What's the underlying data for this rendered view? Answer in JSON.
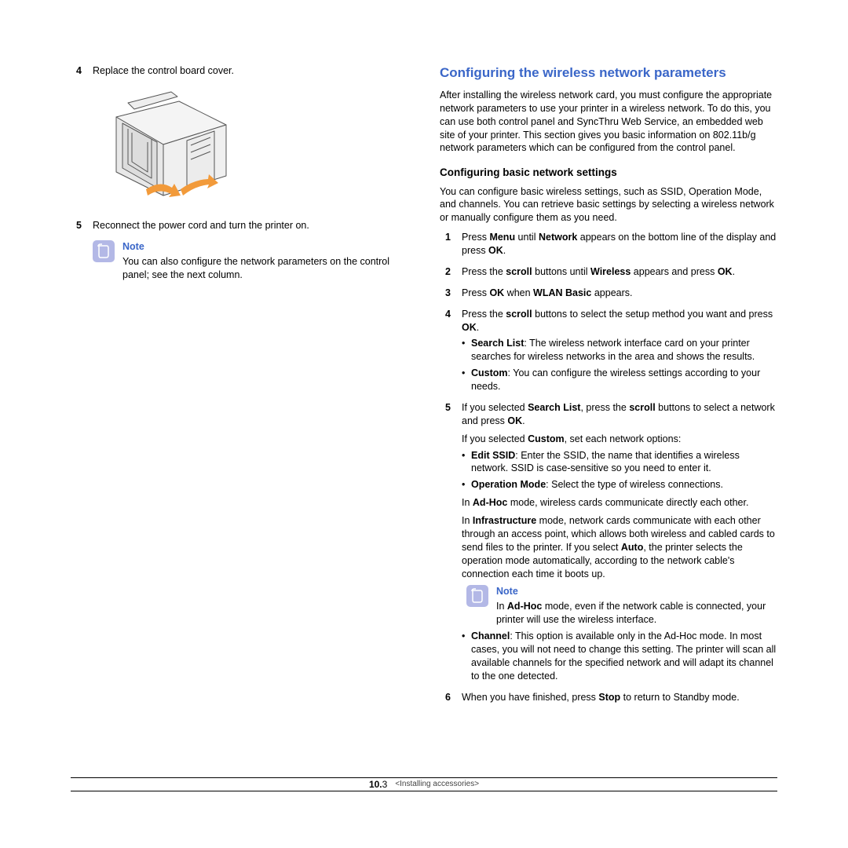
{
  "left": {
    "step4": {
      "num": "4",
      "text": "Replace the control board cover."
    },
    "step5": {
      "num": "5",
      "text": "Reconnect the power cord and turn the printer on."
    },
    "note": {
      "label": "Note",
      "text": "You can also configure the network parameters on the control panel; see the next column."
    }
  },
  "right": {
    "title": "Configuring the wireless network parameters",
    "intro": "After installing the wireless network card, you must configure the appropriate network parameters to use your printer in a wireless network. To do this, you can use both control panel and SyncThru Web Service, an embedded web site of your printer. This section gives you basic information on 802.11b/g network parameters which can be configured from the control panel.",
    "sub1": "Configuring basic network settings",
    "sub1_intro": "You can configure basic wireless settings, such as SSID, Operation Mode, and channels. You can retrieve basic settings by selecting a wireless network or manually configure them as you need.",
    "s1": {
      "num": "1",
      "a": "Press ",
      "b": "Menu",
      "c": " until ",
      "d": "Network",
      "e": " appears on the bottom line of the display and press ",
      "f": "OK",
      "g": "."
    },
    "s2": {
      "num": "2",
      "a": "Press the ",
      "b": "scroll",
      "c": " buttons until ",
      "d": "Wireless",
      "e": " appears and press ",
      "f": "OK",
      "g": "."
    },
    "s3": {
      "num": "3",
      "a": "Press ",
      "b": "OK",
      "c": " when ",
      "d": "WLAN Basic",
      "e": " appears."
    },
    "s4": {
      "num": "4",
      "a": "Press the ",
      "b": "scroll",
      "c": " buttons to select the setup method you want and press ",
      "d": "OK",
      "e": ".",
      "b1_label": "Search List",
      "b1_text": ": The wireless network interface card on your printer searches for wireless networks in the area and shows the results.",
      "b2_label": "Custom",
      "b2_text": ": You can configure the wireless settings according to your needs."
    },
    "s5": {
      "num": "5",
      "line1_a": "If you selected ",
      "line1_b": "Search List",
      "line1_c": ", press the ",
      "line1_d": "scroll",
      "line1_e": " buttons to select a network and press ",
      "line1_f": "OK",
      "line1_g": ".",
      "line2_a": "If you selected ",
      "line2_b": "Custom",
      "line2_c": ", set each network options:",
      "b1_label": "Edit SSID",
      "b1_text": ": Enter the SSID, the name that identifies a wireless network. SSID is case-sensitive so you need to enter it.",
      "b2_label": "Operation Mode",
      "b2_text": ": Select the type of wireless connections.",
      "adhoc_a": "In ",
      "adhoc_b": "Ad-Hoc",
      "adhoc_c": " mode, wireless cards communicate directly each other.",
      "infra_a": "In ",
      "infra_b": "Infrastructure",
      "infra_c": " mode, network cards communicate with each other through an access point, which allows both wireless and cabled cards to send files to the printer. If you select ",
      "infra_d": "Auto",
      "infra_e": ", the printer selects the operation mode automatically, according to the network cable's connection each time it boots up.",
      "note_label": "Note",
      "note_a": "In ",
      "note_b": "Ad-Hoc",
      "note_c": " mode, even if the network cable is connected, your printer will use the wireless interface.",
      "b3_label": "Channel",
      "b3_text": ": This option is available only in the Ad-Hoc mode. In most cases, you will not need to change this setting. The printer will scan all available channels for the specified network and will adapt its channel to the one detected."
    },
    "s6": {
      "num": "6",
      "a": "When you have finished, press ",
      "b": "Stop",
      "c": " to return to Standby mode."
    }
  },
  "footer": {
    "page_major": "10.",
    "page_minor": "3",
    "section": "<Installing accessories>"
  }
}
